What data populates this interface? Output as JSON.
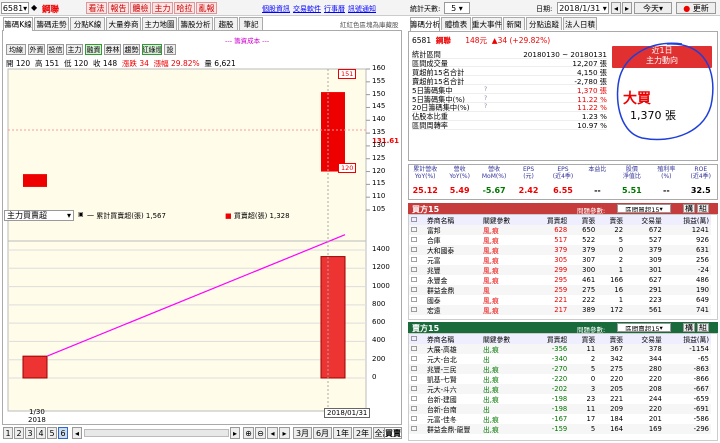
{
  "top": {
    "stock_code": "6581",
    "stock_name": "鋼聯",
    "buttons": [
      "看法",
      "報告",
      "體檢",
      "主力",
      "哈拉",
      "亂報"
    ],
    "links": [
      "個股資訊",
      "交易軟件",
      "行事曆",
      "訊號通知"
    ],
    "days_label": "統計天數:",
    "days": "5",
    "date_label": "日期:",
    "date": "2018/1/31",
    "today": "今天",
    "refresh": "更新"
  },
  "left_tabs": [
    "籌碼K線",
    "籌碼走勢",
    "分點K線",
    "大量券商",
    "主力地圖",
    "籌股分析",
    "趨股",
    "筆記"
  ],
  "hint": "紅紅色區塊為庫藏股",
  "filters": [
    "均線",
    "外資",
    "投信",
    "主力",
    "融資",
    "券林",
    "趨勢",
    "紅綠燈",
    "設"
  ],
  "ohlc": {
    "open": "開 120",
    "high": "高 151",
    "low": "低 120",
    "close": "收 148",
    "change": "漲跌 34",
    "pct": "漲幅 29.82%",
    "vol": "量 6,621"
  },
  "marker": "--- 籌資成本 ---",
  "price_axis": [
    "160",
    "155",
    "150",
    "145",
    "140",
    "135",
    "131.61",
    "130",
    "125",
    "120",
    "115",
    "110",
    "105"
  ],
  "box_labels": {
    "top": "151",
    "bottom": "120"
  },
  "lower": {
    "select": "主力買賣超",
    "legend1": "一 累計買賣超(張) 1,567",
    "legend2": "買賣超(張) 1,328",
    "axis": [
      "1400",
      "1200",
      "1000",
      "800",
      "600",
      "400",
      "200",
      "0"
    ],
    "x_left": "1/30",
    "x_year": "2018",
    "x_right": "2018/01/31"
  },
  "bottom_nav": {
    "pages": [
      "1",
      "2",
      "3",
      "4",
      "5",
      "6"
    ],
    "periods": [
      "3月",
      "6月",
      "1年",
      "2年",
      "全部"
    ],
    "action": "買賣"
  },
  "right_tabs": [
    "籌碼分析",
    "體檢表",
    "重大事件",
    "新聞",
    "分點追蹤",
    "法人日積"
  ],
  "quote": {
    "code": "6581",
    "name": "鋼聯",
    "price": "148元",
    "change": "▲34 (+29.82%)"
  },
  "stats": [
    {
      "k": "統計區間",
      "v": "20180130 ~ 20180131"
    },
    {
      "k": "區間成交量",
      "v": "12,207 張"
    },
    {
      "k": "買超前15名合計",
      "v": "4,150 張"
    },
    {
      "k": "賣超前15名合計",
      "v": "-2,780 張"
    },
    {
      "k": "5日籌碼集中",
      "v": "1,370 張"
    },
    {
      "k": "5日籌碼集中(%)",
      "v": "11.22 %"
    },
    {
      "k": "20日籌碼集中(%)",
      "v": "11.22 %"
    },
    {
      "k": "佔股本比重",
      "v": "1.23 %"
    },
    {
      "k": "區間周轉率",
      "v": "10.97 %"
    }
  ],
  "badge": {
    "l1": "近1日",
    "l2": "主力動向",
    "big": "大買",
    "qty": "1,370 張"
  },
  "kpi": {
    "heads": [
      "累計營收\nYoY(%)",
      "營收\nYoY(%)",
      "營收\nMoM(%)",
      "EPS\n(元)",
      "EPS\n(近4季)",
      "本益比",
      "股價\n淨值比",
      "殖利率\n(%)",
      "ROE\n(近4季)"
    ],
    "vals": [
      "25.12",
      "5.49",
      "-5.67",
      "2.42",
      "6.55",
      "--",
      "5.51",
      "--",
      "32.5"
    ]
  },
  "buy": {
    "title": "買方15",
    "param_label": "問題參數:",
    "param": "區間買超15",
    "cols": [
      "券商名稱",
      "關鍵參數",
      "買賣超",
      "買張",
      "賣張",
      "交易量",
      "損益(萬)"
    ],
    "rows": [
      [
        "富邦",
        "風,痕",
        "628",
        "650",
        "22",
        "672",
        "1241"
      ],
      [
        "合庫",
        "風,痕",
        "517",
        "522",
        "5",
        "527",
        "926"
      ],
      [
        "大和國泰",
        "風,痕",
        "379",
        "379",
        "0",
        "379",
        "631"
      ],
      [
        "元富",
        "風,痕",
        "305",
        "307",
        "2",
        "309",
        "256"
      ],
      [
        "兆豐",
        "風,痕",
        "299",
        "300",
        "1",
        "301",
        "-24"
      ],
      [
        "永豐金",
        "風,痕",
        "295",
        "461",
        "166",
        "627",
        "486"
      ],
      [
        "群益金鼎",
        "風",
        "259",
        "275",
        "16",
        "291",
        "190"
      ],
      [
        "國泰",
        "風,痕",
        "221",
        "222",
        "1",
        "223",
        "649"
      ],
      [
        "宏遠",
        "風,痕",
        "217",
        "389",
        "172",
        "561",
        "741"
      ]
    ]
  },
  "sell": {
    "title": "賣方15",
    "param_label": "問題參數:",
    "param": "區間賣超15",
    "cols": [
      "券商名稱",
      "關鍵參數",
      "買賣超",
      "買張",
      "賣張",
      "交易量",
      "損益(萬)"
    ],
    "rows": [
      [
        "大展-高雄",
        "出,痕",
        "-356",
        "11",
        "367",
        "378",
        "-1154"
      ],
      [
        "元大-台北",
        "出",
        "-340",
        "2",
        "342",
        "344",
        "-65"
      ],
      [
        "兆豐-三民",
        "出,痕",
        "-270",
        "5",
        "275",
        "280",
        "-863"
      ],
      [
        "凱基-七賢",
        "出,痕",
        "-220",
        "0",
        "220",
        "220",
        "-866"
      ],
      [
        "元大-斗六",
        "出,痕",
        "-202",
        "3",
        "205",
        "208",
        "-667"
      ],
      [
        "台新-建國",
        "出,痕",
        "-198",
        "23",
        "221",
        "244",
        "-659"
      ],
      [
        "台新-台南",
        "出",
        "-198",
        "11",
        "209",
        "220",
        "-691"
      ],
      [
        "元富-佳冬",
        "出,痕",
        "-167",
        "17",
        "184",
        "201",
        "-586"
      ],
      [
        "群益金鼎-龍豐",
        "出,痕",
        "-159",
        "5",
        "164",
        "169",
        "-296"
      ]
    ]
  },
  "chart_data": {
    "type": "bar",
    "categories": [
      "2018/01/30",
      "2018/01/31"
    ],
    "candles": [
      {
        "open": 114,
        "close": 119,
        "high": 119,
        "low": 114
      },
      {
        "open": 120,
        "close": 151,
        "high": 151,
        "low": 120
      }
    ],
    "series": [
      {
        "name": "買賣超(張)",
        "values": [
          239,
          1328
        ]
      },
      {
        "name": "累計買賣超(張)",
        "values": [
          239,
          1567
        ]
      }
    ],
    "ylim_price": [
      105,
      160
    ],
    "ylim_vol": [
      0,
      1400
    ]
  }
}
